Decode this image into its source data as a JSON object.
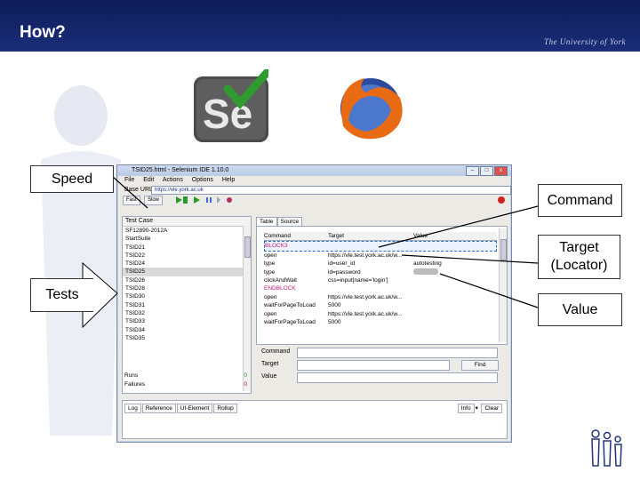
{
  "slide": {
    "title": "How?",
    "university_logo": "The University of York"
  },
  "callouts": {
    "speed": "Speed",
    "tests": "Tests",
    "command": "Command",
    "target": "Target\n(Locator)",
    "value": "Value"
  },
  "ide": {
    "window_title": "TSID25.html - Selenium IDE 1.10.0",
    "menu": [
      "File",
      "Edit",
      "Actions",
      "Options",
      "Help"
    ],
    "base_url_label": "Base URL",
    "base_url_value": "https://vle.york.ac.uk",
    "speed_fast": "Fast",
    "speed_slow": "Slow",
    "test_case_header": "Test Case",
    "test_cases": [
      "SF12890-2012A",
      "StartSuite",
      "TSID21",
      "TSID22",
      "TSID24",
      "TSID25",
      "TSID26",
      "TSID28",
      "TSID30",
      "TSID31",
      "TSID32",
      "TSID33",
      "TSID34",
      "TSID35"
    ],
    "selected_test_case": "TSID25",
    "runs_label": "Runs",
    "runs_value": "0",
    "failures_label": "Failures",
    "failures_value": "0",
    "tabs": [
      "Table",
      "Source"
    ],
    "columns": [
      "Command",
      "Target",
      "Value"
    ],
    "commands": [
      {
        "command": "BLOCK3",
        "target": "",
        "value": "",
        "style": "pink"
      },
      {
        "command": "open",
        "target": "https://vle.test.york.ac.uk/w...",
        "value": ""
      },
      {
        "command": "type",
        "target": "id=user_id",
        "value": "autotesting"
      },
      {
        "command": "type",
        "target": "id=password",
        "value": ""
      },
      {
        "command": "clickAndWait",
        "target": "css=input[name='login']",
        "value": ""
      },
      {
        "command": "ENDBLOCK",
        "target": "",
        "value": "",
        "style": "pink"
      },
      {
        "command": "open",
        "target": "https://vle.test.york.ac.uk/w...",
        "value": ""
      },
      {
        "command": "waitForPageToLoad",
        "target": "5000",
        "value": ""
      },
      {
        "command": "open",
        "target": "https://vle.test.york.ac.uk/w...",
        "value": ""
      },
      {
        "command": "waitForPageToLoad",
        "target": "5000",
        "value": ""
      }
    ],
    "form": {
      "command_label": "Command",
      "target_label": "Target",
      "value_label": "Value",
      "find_button": "Find"
    },
    "log_tabs": [
      "Log",
      "Reference",
      "UI-Element",
      "Rollup"
    ],
    "info_label": "Info",
    "clear_label": "Clear"
  }
}
